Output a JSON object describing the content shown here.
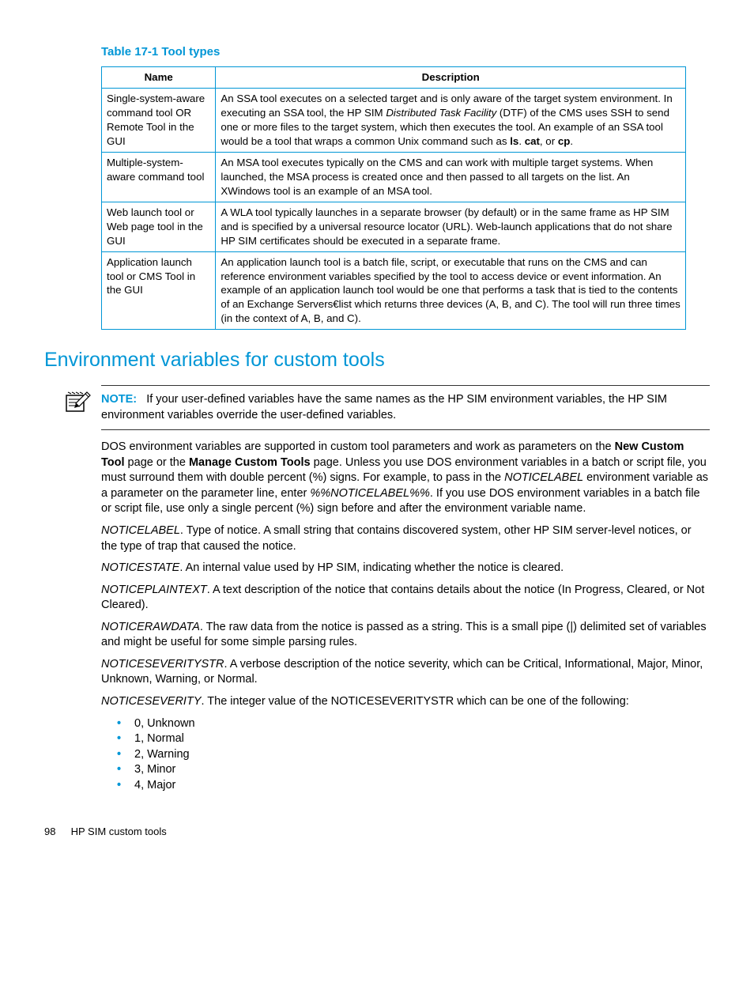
{
  "table": {
    "caption": "Table 17-1 Tool types",
    "headers": {
      "name": "Name",
      "desc": "Description"
    },
    "rows": [
      {
        "name": "Single-system-aware command tool OR Remote Tool in the GUI",
        "desc_pre": "An SSA tool executes on a selected target and is only aware of the target system environment. In executing an SSA tool, the HP SIM ",
        "desc_italic": "Distributed Task Facility",
        "desc_mid": " (DTF) of the CMS uses SSH to send one or more files to the target system, which then executes the tool. An example of an SSA tool would be a tool that wraps a common Unix command such as ",
        "ls": "ls",
        "dot1": ". ",
        "cat": "cat",
        "comma": ", or ",
        "cp": "cp",
        "dot2": "."
      },
      {
        "name": "Multiple-system-aware command tool",
        "desc": "An MSA tool executes typically on the CMS and can work with multiple target systems. When launched, the MSA process is created once and then passed to all targets on the list. An XWindows tool is an example of an MSA tool."
      },
      {
        "name": "Web launch tool or Web page tool in the GUI",
        "desc": "A WLA tool typically launches in a separate browser (by default) or in the same frame as HP SIM and is specified by a universal resource locator (URL). Web-launch applications that do not share HP SIM certificates should be executed in a separate frame."
      },
      {
        "name": "Application launch tool or CMS Tool in the GUI",
        "desc": "An application launch tool is a batch file, script, or executable that runs on the CMS and can reference environment variables specified by the tool to access device or event information. An example of an application launch tool would be one that performs a task that is tied to the contents of an Exchange Servers€list which returns three devices (A, B, and C). The tool will run three times (in the context of A, B, and C)."
      }
    ]
  },
  "section_title": "Environment variables for custom tools",
  "note": {
    "label": "NOTE:",
    "text": "If your user-defined variables have the same names as the HP SIM environment variables, the HP SIM environment variables override the user-defined variables."
  },
  "paras": {
    "intro_pre": "DOS environment variables are supported in custom tool parameters and work as parameters on the ",
    "intro_bold1": "New Custom Tool",
    "intro_mid1": " page or the ",
    "intro_bold2": "Manage Custom Tools",
    "intro_mid2": " page. Unless you use DOS environment variables in a batch or script file, you must surround them with double percent (%) signs. For example, to pass in the ",
    "intro_it1": "NOTICELABEL",
    "intro_mid3": " environment variable as a parameter on the parameter line, enter ",
    "intro_it2": "%%NOTICELABEL%%",
    "intro_post": ". If you use DOS environment variables in a batch file or script file, use only a single percent (%) sign before and after the environment variable name.",
    "p2_it": "NOTICELABEL",
    "p2": ". Type of notice. A small string that contains discovered system, other HP SIM server-level notices, or the type of trap that caused the notice.",
    "p3_it": "NOTICESTATE",
    "p3": ". An internal value used by HP SIM, indicating whether the notice is cleared.",
    "p4_it": "NOTICEPLAINTEXT",
    "p4": ". A text description of the notice that contains details about the notice (In Progress, Cleared, or Not Cleared).",
    "p5_it": "NOTICERAWDATA",
    "p5": ". The raw data from the notice is passed as a string. This is a small pipe (|) delimited set of variables and might be useful for some simple parsing rules.",
    "p6_it": "NOTICESEVERITYSTR",
    "p6": ". A verbose description of the notice severity, which can be Critical, Informational, Major, Minor, Unknown, Warning, or Normal.",
    "p7_it": "NOTICESEVERITY",
    "p7": ". The integer value of the NOTICESEVERITYSTR which can be one of the following:"
  },
  "severity_list": [
    "0, Unknown",
    "1, Normal",
    "2, Warning",
    "3, Minor",
    "4, Major"
  ],
  "footer": {
    "pagenum": "98",
    "title": "HP SIM custom tools"
  }
}
